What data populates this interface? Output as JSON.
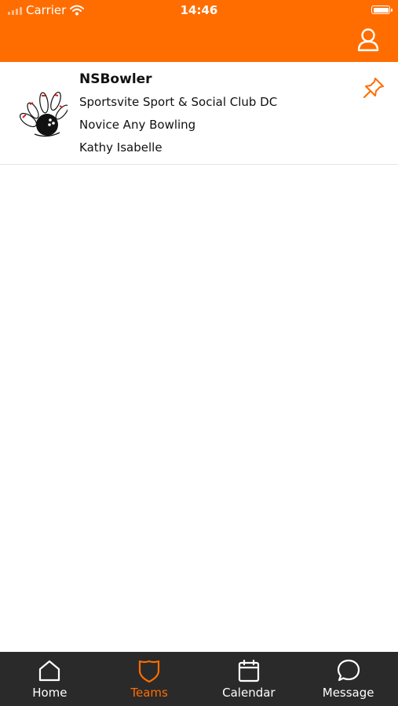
{
  "status_bar": {
    "carrier": "Carrier",
    "time": "14:46"
  },
  "colors": {
    "accent": "#ff6d00",
    "tabbar_bg": "#2a2a2a"
  },
  "header": {
    "profile_icon": "user-icon"
  },
  "teams": [
    {
      "name": "NSBowler",
      "club": "Sportsvite Sport & Social Club DC",
      "division": "Novice Any Bowling",
      "captain": "Kathy Isabelle",
      "logo_icon": "bowling-logo",
      "pin_icon": "pin-icon"
    }
  ],
  "tabs": [
    {
      "label": "Home",
      "icon": "home-icon",
      "active": false
    },
    {
      "label": "Teams",
      "icon": "shield-icon",
      "active": true
    },
    {
      "label": "Calendar",
      "icon": "calendar-icon",
      "active": false
    },
    {
      "label": "Message",
      "icon": "message-icon",
      "active": false
    }
  ]
}
